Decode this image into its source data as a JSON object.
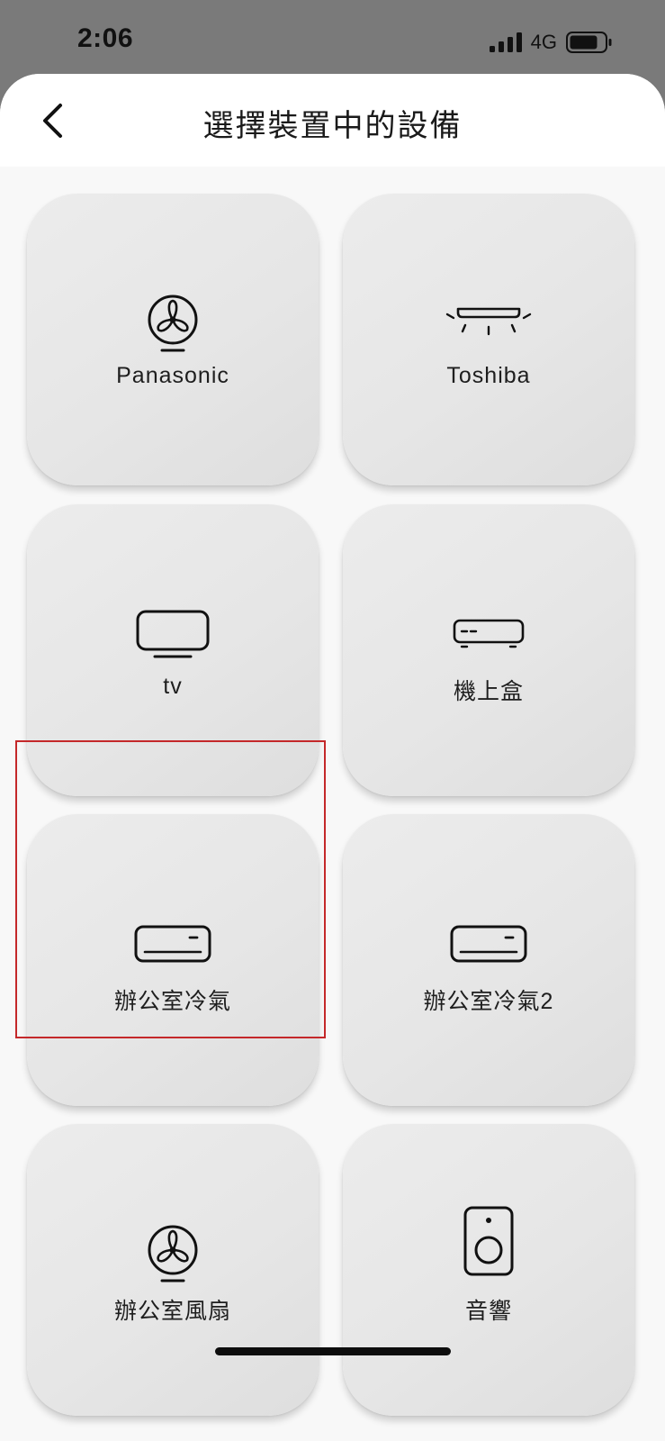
{
  "status_bar": {
    "time": "2:06",
    "network": "4G",
    "icons": [
      "signal-bars-icon",
      "battery-icon"
    ]
  },
  "header": {
    "title": "選擇裝置中的設備",
    "back_icon": "chevron-left-icon"
  },
  "devices": [
    {
      "label": "Panasonic",
      "icon": "fan-icon"
    },
    {
      "label": "Toshiba",
      "icon": "ceiling-ac-icon"
    },
    {
      "label": "tv",
      "icon": "tv-icon"
    },
    {
      "label": "機上盒",
      "icon": "set-top-box-icon"
    },
    {
      "label": "辦公室冷氣",
      "icon": "air-conditioner-icon"
    },
    {
      "label": "辦公室冷氣2",
      "icon": "air-conditioner-icon"
    },
    {
      "label": "辦公室風扇",
      "icon": "fan-icon"
    },
    {
      "label": "音響",
      "icon": "speaker-icon"
    }
  ],
  "colors": {
    "highlight_border": "#c4282a",
    "tile_background": "#e6e6e6",
    "page_background": "#f8f8f8",
    "status_bar_background": "#7a7a7a"
  }
}
